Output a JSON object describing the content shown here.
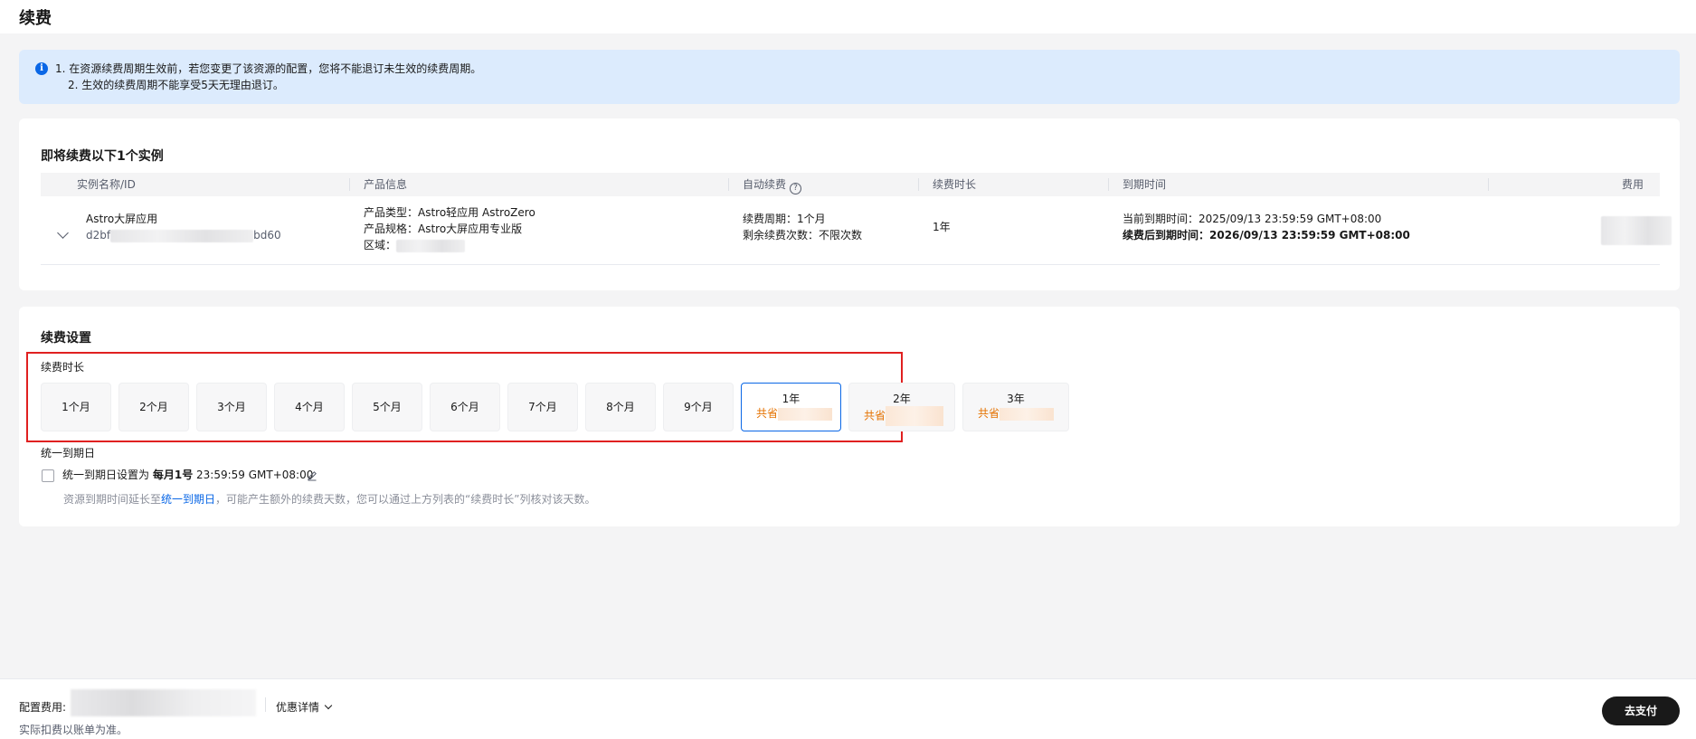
{
  "page": {
    "title": "续费"
  },
  "notice": {
    "icon": "info-icon",
    "lines": [
      "1. 在资源续费周期生效前，若您变更了该资源的配置，您将不能退订未生效的续费周期。",
      "2. 生效的续费周期不能享受5天无理由退订。"
    ]
  },
  "instances": {
    "title": "即将续费以下1个实例",
    "columns": [
      "实例名称/ID",
      "产品信息",
      "自动续费",
      "续费时长",
      "到期时间",
      "费用"
    ],
    "rows": [
      {
        "name": "Astro大屏应用",
        "id_prefix": "d2bf",
        "id_suffix": "bd60",
        "product_type": "产品类型：Astro轻应用 AstroZero",
        "product_spec": "产品规格：Astro大屏应用专业版",
        "region_label": "区域：",
        "renew_cycle": "续费周期：1个月",
        "renew_remaining": "剩余续费次数：不限次数",
        "duration": "1年",
        "current_expire": "当前到期时间：2025/09/13 23:59:59 GMT+08:00",
        "after_expire": "续费后到期时间：2026/09/13 23:59:59 GMT+08:00"
      }
    ]
  },
  "settings": {
    "title": "续费设置",
    "duration_label": "续费时长",
    "options": [
      "1个月",
      "2个月",
      "3个月",
      "4个月",
      "5个月",
      "6个月",
      "7个月",
      "8个月",
      "9个月",
      "1年",
      "2年",
      "3年"
    ],
    "selected": "1年",
    "saving_prefix": "共省",
    "unify_label": "统一到期日",
    "unify_checkbox_prefix": "统一到期日设置为",
    "unify_day": "每月1号",
    "unify_time": "23:59:59 GMT+08:00",
    "unify_checked": false,
    "hint_prefix": "资源到期时间延长至",
    "hint_link": "统一到期日",
    "hint_suffix": "，可能产生额外的续费天数，您可以通过上方列表的“续费时长”列核对该天数。"
  },
  "footer": {
    "price_label": "配置费用:",
    "discount_label": "优惠详情",
    "note": "实际扣费以账单为准。",
    "pay_button": "去支付"
  },
  "colors": {
    "accent": "#0a67e6",
    "highlight": "#e02020",
    "saving": "#e57200",
    "notice_bg": "#dcebfd"
  }
}
